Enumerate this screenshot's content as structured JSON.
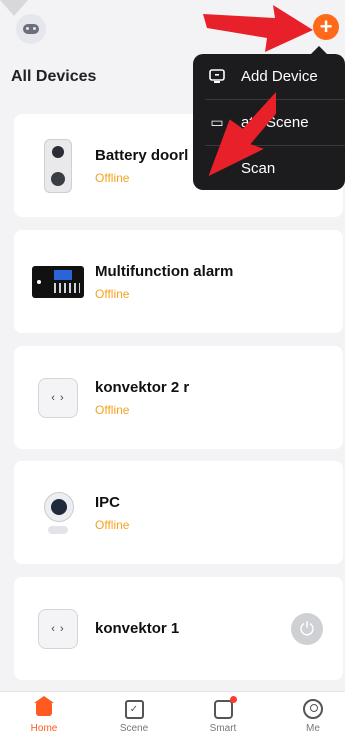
{
  "header": {
    "title": "All Devices"
  },
  "menu": {
    "items": [
      {
        "label": "Add Device",
        "icon": "add-device-icon"
      },
      {
        "label": "Create Scene",
        "icon": "create-scene-icon"
      },
      {
        "label": "Scan",
        "icon": "scan-icon"
      }
    ],
    "visible_labels": [
      "Add Device",
      "ate Scene",
      "Scan"
    ]
  },
  "devices": [
    {
      "name": "Battery doorbell",
      "visible_name": "Battery doorl",
      "status": "Offline",
      "icon": "doorbell-icon"
    },
    {
      "name": "Multifunction alarm",
      "status": "Offline",
      "icon": "alarm-panel-icon"
    },
    {
      "name": "konvektor 2 r",
      "status": "Offline",
      "icon": "smart-plug-icon"
    },
    {
      "name": "IPC",
      "status": "Offline",
      "icon": "ip-camera-icon"
    },
    {
      "name": "konvektor 1",
      "status": "",
      "icon": "smart-plug-icon"
    }
  ],
  "tabs": [
    {
      "label": "Home",
      "active": true
    },
    {
      "label": "Scene",
      "active": false
    },
    {
      "label": "Smart",
      "active": false
    },
    {
      "label": "Me",
      "active": false
    }
  ],
  "colors": {
    "accent": "#ff5a1f",
    "offline": "#f3a321",
    "menu_bg": "#1c1c1e",
    "arrow": "#e8202a"
  }
}
